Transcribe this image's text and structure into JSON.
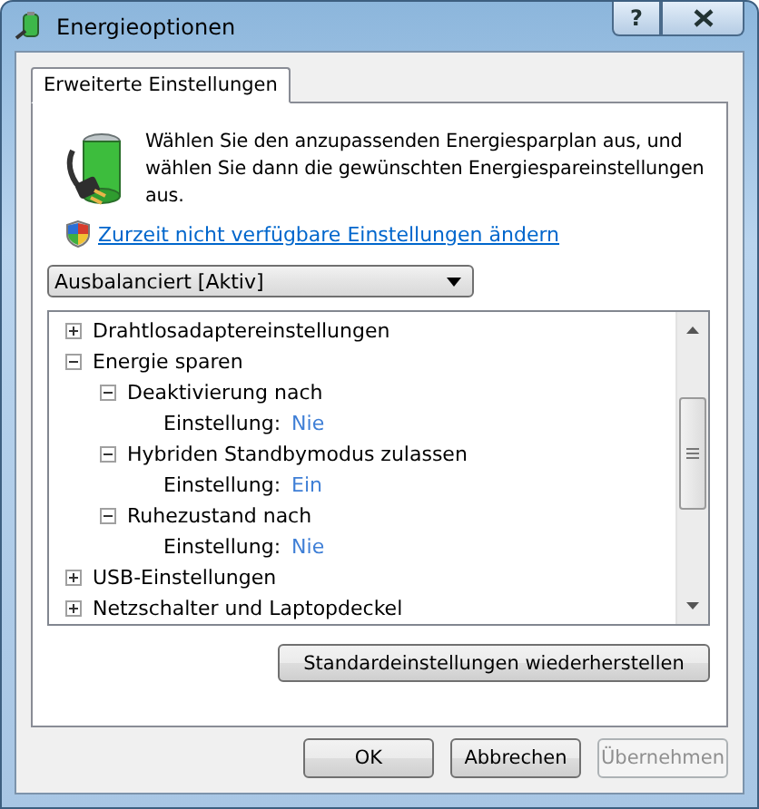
{
  "window": {
    "title": "Energieoptionen",
    "help_button": "?"
  },
  "tabs": [
    {
      "label": "Erweiterte Einstellungen",
      "selected": true
    }
  ],
  "intro": "Wählen Sie den anzupassenden Energiesparplan aus, und wählen Sie dann die gewünschten Energiespareinstellungen aus.",
  "admin_link": "Zurzeit nicht verfügbare Einstellungen ändern",
  "plan_dropdown": {
    "value": "Ausbalanciert [Aktiv]"
  },
  "tree": [
    {
      "label": "Drahtlosadaptereinstellungen",
      "expanded": false
    },
    {
      "label": "Energie sparen",
      "expanded": true,
      "children": [
        {
          "label": "Deaktivierung nach",
          "expanded": true,
          "setting": {
            "label": "Einstellung:",
            "value": "Nie"
          }
        },
        {
          "label": "Hybriden Standbymodus zulassen",
          "expanded": true,
          "setting": {
            "label": "Einstellung:",
            "value": "Ein"
          }
        },
        {
          "label": "Ruhezustand nach",
          "expanded": true,
          "setting": {
            "label": "Einstellung:",
            "value": "Nie"
          }
        }
      ]
    },
    {
      "label": "USB-Einstellungen",
      "expanded": false
    },
    {
      "label": "Netzschalter und Laptopdeckel",
      "expanded": false
    }
  ],
  "restore_button": "Standardeinstellungen wiederherstellen",
  "buttons": [
    {
      "label": "OK",
      "disabled": false
    },
    {
      "label": "Abbrechen",
      "disabled": false
    },
    {
      "label": "Übernehmen",
      "disabled": true
    }
  ]
}
